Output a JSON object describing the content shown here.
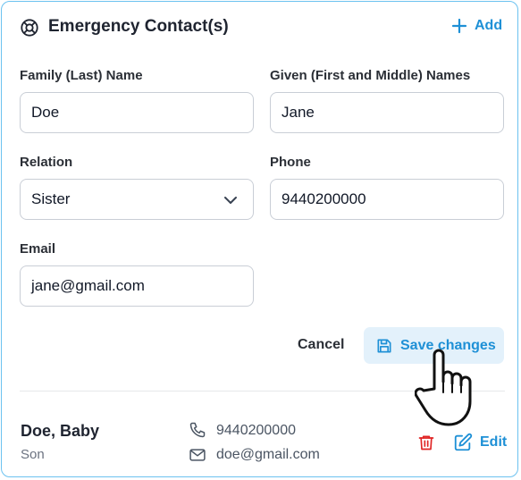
{
  "card": {
    "title": "Emergency Contact(s)",
    "add_label": "Add"
  },
  "form": {
    "family_name": {
      "label": "Family (Last) Name",
      "value": "Doe"
    },
    "given_name": {
      "label": "Given (First and Middle) Names",
      "value": "Jane"
    },
    "relation": {
      "label": "Relation",
      "value": "Sister"
    },
    "phone": {
      "label": "Phone",
      "value": "9440200000"
    },
    "email": {
      "label": "Email",
      "value": "jane@gmail.com"
    }
  },
  "actions": {
    "cancel_label": "Cancel",
    "save_label": "Save changes"
  },
  "contact": {
    "name": "Doe, Baby",
    "relation": "Son",
    "phone": "9440200000",
    "email": "doe@gmail.com",
    "edit_label": "Edit"
  },
  "colors": {
    "accent": "#1e90d6",
    "danger": "#e02424",
    "border": "#6cc2f0"
  },
  "icons": [
    "lifebuoy-icon",
    "plus-icon",
    "chevron-down-icon",
    "save-icon",
    "phone-icon",
    "mail-icon",
    "trash-icon",
    "edit-icon",
    "hand-pointer-cursor"
  ]
}
